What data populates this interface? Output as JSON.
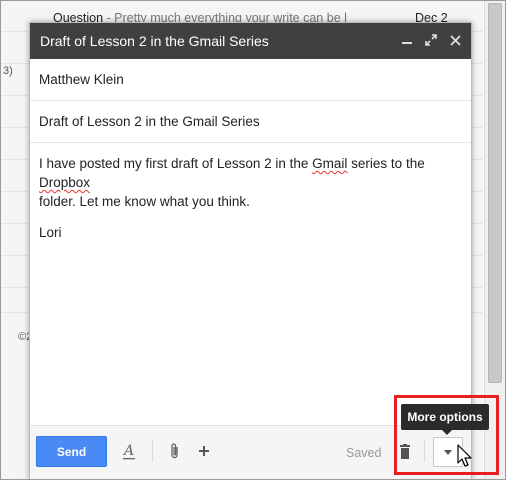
{
  "background": {
    "row_top": {
      "subject": "Question",
      "snippet": "- Pretty much everything your write can be l",
      "date": "Dec 2"
    },
    "left_mark": "3)",
    "copyright": "©2"
  },
  "compose": {
    "title": "Draft of Lesson 2 in the Gmail Series",
    "header_icons": [
      "minimize-icon",
      "pop-out-icon",
      "close-icon"
    ],
    "to": "Matthew Klein",
    "subject": "Draft of Lesson 2 in the Gmail Series",
    "body": {
      "line1_a": "I have posted my first draft of Lesson 2 in the ",
      "line1_b": "Gmail",
      "line1_c": " series to the ",
      "line1_d": "Dropbox",
      "line2": "folder. Let me know what you think.",
      "signature": "Lori"
    },
    "toolbar": {
      "send_label": "Send",
      "saved_label": "Saved",
      "more_options_tooltip": "More options"
    }
  },
  "colors": {
    "header_bg": "#404040",
    "send_button": "#4a8af4",
    "highlight_box": "#e81f1f",
    "tooltip_bg": "#2b2b2b"
  }
}
